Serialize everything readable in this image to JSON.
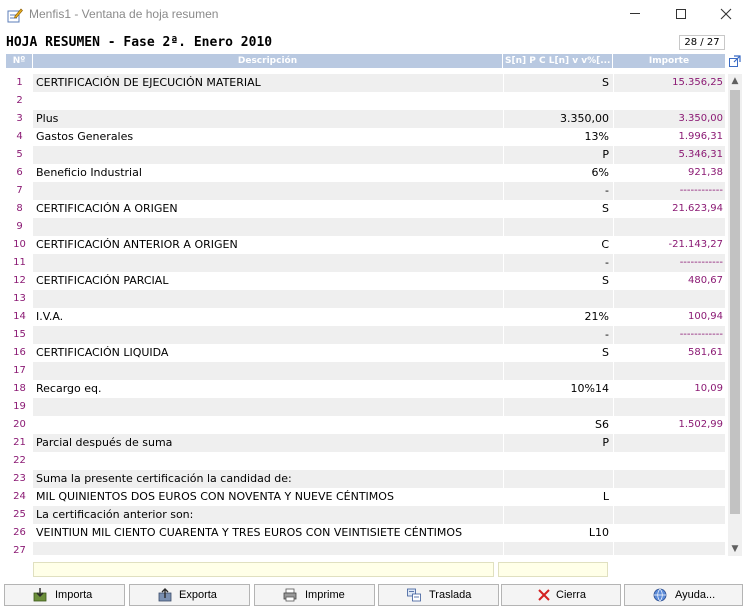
{
  "window": {
    "title": "Menfis1 - Ventana de hoja resumen"
  },
  "sheet": {
    "title": "HOJA RESUMEN - Fase 2ª. Enero 2010",
    "page_counter": "28 / 27"
  },
  "columns": {
    "num": "Nº",
    "desc": "Descripción",
    "spc": "S[n] P C L[n] v v%[...",
    "imp": "Importe"
  },
  "rows": [
    {
      "num": "1",
      "desc": "CERTIFICACIÓN DE EJECUCIÓN MATERIAL",
      "spc": "S",
      "imp": "15.356,25"
    },
    {
      "num": "2",
      "desc": "",
      "spc": "",
      "imp": ""
    },
    {
      "num": "3",
      "desc": "Plus",
      "spc": "3.350,00",
      "imp": "3.350,00"
    },
    {
      "num": "4",
      "desc": "Gastos Generales",
      "spc": "13%",
      "imp": "1.996,31"
    },
    {
      "num": "5",
      "desc": "",
      "spc": "P",
      "imp": "5.346,31"
    },
    {
      "num": "6",
      "desc": "Beneficio Industrial",
      "spc": "6%",
      "imp": "921,38"
    },
    {
      "num": "7",
      "desc": "",
      "spc": "-",
      "imp": "------------"
    },
    {
      "num": "8",
      "desc": "CERTIFICACIÓN A ORIGEN",
      "spc": "S",
      "imp": "21.623,94"
    },
    {
      "num": "9",
      "desc": "",
      "spc": "",
      "imp": ""
    },
    {
      "num": "10",
      "desc": "CERTIFICACIÓN ANTERIOR A ORIGEN",
      "spc": "C",
      "imp": "-21.143,27"
    },
    {
      "num": "11",
      "desc": "",
      "spc": "-",
      "imp": "------------"
    },
    {
      "num": "12",
      "desc": "CERTIFICACIÓN PARCIAL",
      "spc": "S",
      "imp": "480,67"
    },
    {
      "num": "13",
      "desc": "",
      "spc": "",
      "imp": ""
    },
    {
      "num": "14",
      "desc": "I.V.A.",
      "spc": "21%",
      "imp": "100,94"
    },
    {
      "num": "15",
      "desc": "",
      "spc": "-",
      "imp": "------------"
    },
    {
      "num": "16",
      "desc": "CERTIFICACIÓN LIQUIDA",
      "spc": "S",
      "imp": "581,61"
    },
    {
      "num": "17",
      "desc": "",
      "spc": "",
      "imp": ""
    },
    {
      "num": "18",
      "desc": "Recargo eq.",
      "spc": "10%14",
      "imp": "10,09"
    },
    {
      "num": "19",
      "desc": "",
      "spc": "",
      "imp": ""
    },
    {
      "num": "20",
      "desc": "",
      "spc": "S6",
      "imp": "1.502,99"
    },
    {
      "num": "21",
      "desc": "Parcial después de suma",
      "spc": "P",
      "imp": ""
    },
    {
      "num": "22",
      "desc": "",
      "spc": "",
      "imp": ""
    },
    {
      "num": "23",
      "desc": "Suma la presente certificación la candidad de:",
      "spc": "",
      "imp": ""
    },
    {
      "num": "24",
      "desc": "MIL QUINIENTOS DOS EUROS CON NOVENTA Y NUEVE CÉNTIMOS",
      "spc": "L",
      "imp": ""
    },
    {
      "num": "25",
      "desc": "La certificación anterior son:",
      "spc": "",
      "imp": ""
    },
    {
      "num": "26",
      "desc": "VEINTIUN MIL CIENTO CUARENTA Y TRES EUROS CON VEINTISIETE CÉNTIMOS",
      "spc": "L10",
      "imp": ""
    },
    {
      "num": "27",
      "desc": "",
      "spc": "",
      "imp": ""
    }
  ],
  "buttons": {
    "importa": "Importa",
    "exporta": "Exporta",
    "imprime": "Imprime",
    "traslada": "Traslada",
    "cierra": "Cierra",
    "ayuda": "Ayuda..."
  },
  "icons": {
    "app": "edit-sheet-icon",
    "popout": "external-link-icon",
    "importa": "import-icon",
    "exporta": "export-icon",
    "imprime": "printer-icon",
    "traslada": "transfer-icon",
    "cierra": "close-x-icon",
    "ayuda": "help-globe-icon"
  },
  "colors": {
    "header_bg": "#b9c9e1",
    "number_text": "#8b1a74",
    "row_alt": "#efefef",
    "input_bg": "#ffffe8",
    "cierra_icon": "#d42020"
  }
}
